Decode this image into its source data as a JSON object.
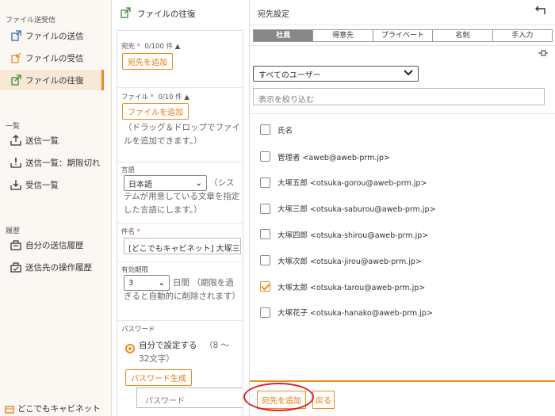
{
  "sidebar": {
    "section_send": "ファイル送受信",
    "items_send": [
      {
        "label": "ファイルの送信",
        "icon": "upload-file-icon",
        "active": false
      },
      {
        "label": "ファイルの受信",
        "icon": "download-file-icon",
        "active": false
      },
      {
        "label": "ファイルの往復",
        "icon": "roundtrip-file-icon",
        "active": true
      }
    ],
    "section_list": "一覧",
    "items_list": [
      {
        "label": "送信一覧",
        "icon": "outbox-icon"
      },
      {
        "label": "送信一覧：期限切れ",
        "icon": "outbox-expired-icon"
      },
      {
        "label": "受信一覧",
        "icon": "inbox-icon"
      }
    ],
    "section_history": "履歴",
    "items_history": [
      {
        "label": "自分の送信履歴",
        "icon": "send-history-icon"
      },
      {
        "label": "送信先の操作履歴",
        "icon": "recipient-history-icon"
      }
    ],
    "footer": "どこでもキャビネット"
  },
  "form": {
    "title": "ファイルの往復",
    "recipients_label": "宛先",
    "required_mark": "*",
    "recipients_count": "0/100 件",
    "add_recipient_button": "宛先を追加",
    "file_label": "ファイル",
    "file_count": "0/10 件",
    "add_file_button": "ファイルを追加",
    "file_help": "（ドラッグ＆ドロップでファイルを追加できます。）",
    "language_label": "言語",
    "language_value": "日本語",
    "language_help_1": "（シス",
    "language_help_2": "テムが用意している文章を指定した言語にします。）",
    "subject_label": "件名",
    "subject_value": "[どこでもキャビネット] 大塚三",
    "expiry_label": "有効期限",
    "expiry_value": "3",
    "expiry_unit": "日間",
    "expiry_help_1": "（期限を過",
    "expiry_help_2": "ぎると自動的に削除されます）",
    "password_label": "パスワード",
    "password_option": "自分で設定する",
    "password_option_hint_1": "（8 〜",
    "password_option_hint_2": "32文字）",
    "password_generate_button": "パスワード生成",
    "password_placeholder": "パスワード"
  },
  "panel": {
    "title": "宛先設定",
    "tabs": [
      "社員",
      "得意先",
      "プライベート",
      "名刺",
      "手入力"
    ],
    "active_tab": 0,
    "user_filter_select": "すべてのユーザー",
    "filter_placeholder": "表示を絞り込む",
    "name_header": "氏名",
    "rows": [
      {
        "text": "管理者 <aweb@aweb-prm.jp>",
        "checked": false
      },
      {
        "text": "大塚五郎 <otsuka-gorou@aweb-prm.jp>",
        "checked": false
      },
      {
        "text": "大塚三郎 <otsuka-saburou@aweb-prm.jp>",
        "checked": false
      },
      {
        "text": "大塚四郎 <otsuka-shirou@aweb-prm.jp>",
        "checked": false
      },
      {
        "text": "大塚次郎 <otsuka-jirou@aweb-prm.jp>",
        "checked": false
      },
      {
        "text": "大塚太郎 <otsuka-tarou@aweb-prm.jp>",
        "checked": true
      },
      {
        "text": "大塚花子 <otsuka-hanako@aweb-prm.jp>",
        "checked": false
      }
    ],
    "add_button": "宛先を追加",
    "back_button": "戻る"
  },
  "colors": {
    "accent": "#f08a1c",
    "highlight_ellipse": "#e01f1f",
    "active_tab": "#888888"
  }
}
